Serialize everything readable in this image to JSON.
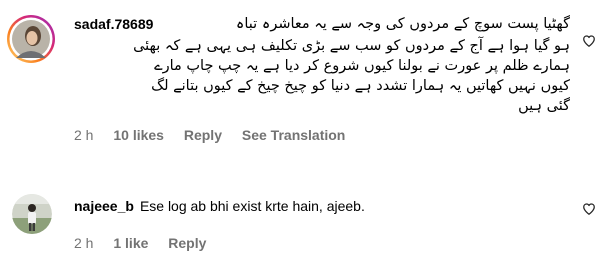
{
  "comments": [
    {
      "username": "sadaf.78689",
      "text_lines": [
        "گھٹیا پست سوچ کے مردوں کی وجہ سے یہ معاشرہ تباہ",
        "ہو گیا ہوا ہے آج کے مردوں کو سب سے بڑی تکلیف ہی یہی ہے کہ بھئی",
        "ہمارے ظلم پر عورت نے بولنا کیوں شروع کر دیا ہے یہ چپ چاپ مارے",
        "کیوں نہیں کھاتیں یہ ہمارا تشدد ہے دنیا کو چیخ چیخ کے کیوں بتانے لگ",
        "گئی ہیں"
      ],
      "time": "2 h",
      "likes": "10 likes",
      "reply": "Reply",
      "see_translation": "See Translation",
      "like_icon": "heart-outline-icon"
    },
    {
      "username": "najeee_b",
      "text": "Ese log ab bhi exist krte hain, ajeeb.",
      "time": "2 h",
      "likes": "1 like",
      "reply": "Reply",
      "like_icon": "heart-outline-icon"
    }
  ],
  "colors": {
    "text": "#000000",
    "meta": "#737373",
    "story_ring": "#d62976"
  }
}
